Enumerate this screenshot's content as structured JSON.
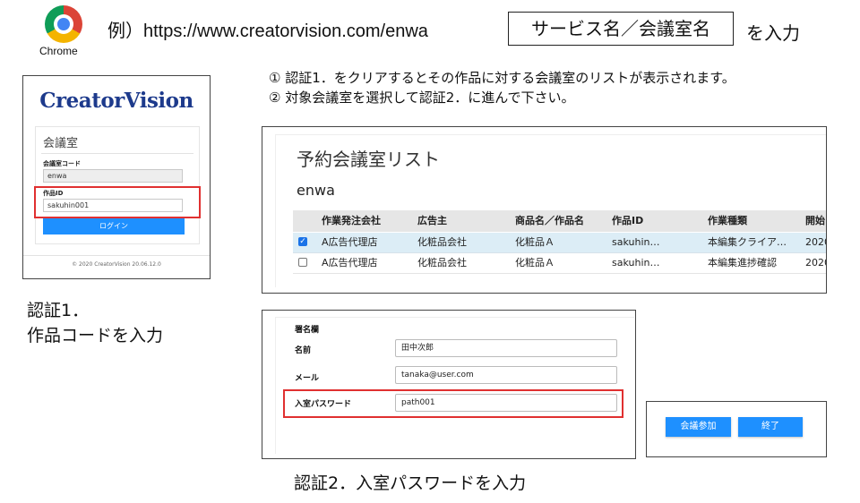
{
  "header": {
    "browser_label": "Chrome",
    "url_example": "例）https://www.creatorvision.com/enwa",
    "service_box": "サービス名／会議室名",
    "input_suffix": "を入力"
  },
  "instructions": [
    "① 認証1．をクリアするとその作品に対する会議室のリストが表示されます。",
    "② 対象会議室を選択して認証2．に進んで下さい。"
  ],
  "login": {
    "logo": "CreatorVision",
    "heading": "会議室",
    "room_code_label": "会議室コード",
    "room_code_value": "enwa",
    "work_id_label": "作品ID",
    "work_id_value": "sakuhin001",
    "login_button": "ログイン",
    "footer": "© 2020 CreatorVision 20.06.12.0"
  },
  "auth1_caption": [
    "認証1．",
    "作品コードを入力"
  ],
  "room_list": {
    "title": "予約会議室リスト",
    "subtitle": "enwa",
    "columns": [
      "作業発注会社",
      "広告主",
      "商品名／作品名",
      "作品ID",
      "作業種類",
      "開始"
    ],
    "rows": [
      {
        "selected": true,
        "cells": [
          "A広告代理店",
          "化粧品会社",
          "化粧品Ａ",
          "sakuhin…",
          "本編集クライア…",
          "2020"
        ]
      },
      {
        "selected": false,
        "cells": [
          "A広告代理店",
          "化粧品会社",
          "化粧品Ａ",
          "sakuhin…",
          "本編集進捗確認",
          "2020"
        ]
      }
    ]
  },
  "signature": {
    "heading": "署名欄",
    "name_label": "名前",
    "name_value": "田中次郎",
    "mail_label": "メール",
    "mail_value": "tanaka@user.com",
    "password_label": "入室パスワード",
    "password_value": "path001"
  },
  "auth2_caption": "認証2．入室パスワードを入力",
  "actions": {
    "join_button": "会議参加",
    "end_button": "終了"
  },
  "colors": {
    "accent_blue": "#1e90ff",
    "highlight_red": "#e03030",
    "logo_navy": "#1d3a8c",
    "selected_row": "#dcedf6"
  }
}
